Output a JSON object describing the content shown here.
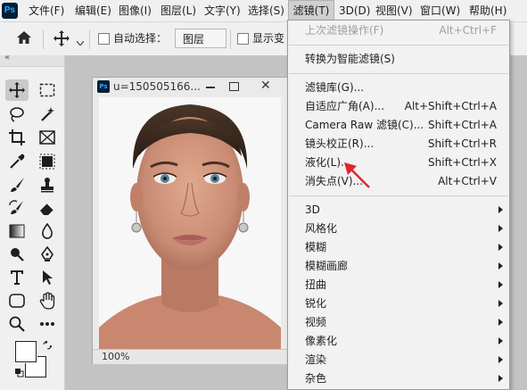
{
  "menubar": {
    "logo": "Ps",
    "items": [
      "文件(F)",
      "编辑(E)",
      "图像(I)",
      "图层(L)",
      "文字(Y)",
      "选择(S)",
      "滤镜(T)",
      "3D(D)",
      "视图(V)",
      "窗口(W)",
      "帮助(H)"
    ],
    "active": "滤镜(T)"
  },
  "options": {
    "auto_select_label": "自动选择：",
    "auto_select_value": "图层",
    "show_transform_label": "显示变"
  },
  "document": {
    "title": "u=150505166...",
    "zoom": "100%"
  },
  "filter_menu": {
    "last_filter": {
      "label": "上次滤镜操作(F)",
      "shortcut": "Alt+Ctrl+F"
    },
    "convert_smart": "转换为智能滤镜(S)",
    "group2": [
      {
        "label": "滤镜库(G)...",
        "shortcut": ""
      },
      {
        "label": "自适应广角(A)...",
        "shortcut": "Alt+Shift+Ctrl+A"
      },
      {
        "label": "Camera Raw 滤镜(C)...",
        "shortcut": "Shift+Ctrl+A"
      },
      {
        "label": "镜头校正(R)...",
        "shortcut": "Shift+Ctrl+R"
      },
      {
        "label": "液化(L)...",
        "shortcut": "Shift+Ctrl+X"
      },
      {
        "label": "消失点(V)...",
        "shortcut": "Alt+Ctrl+V"
      }
    ],
    "submenus": [
      "3D",
      "风格化",
      "模糊",
      "模糊画廊",
      "扭曲",
      "锐化",
      "视频",
      "像素化",
      "渲染",
      "杂色"
    ]
  },
  "colors": {
    "annotation_arrow": "#e3242b",
    "menu_bg": "#f2f2f2",
    "workspace_bg": "#c3c3c3"
  }
}
